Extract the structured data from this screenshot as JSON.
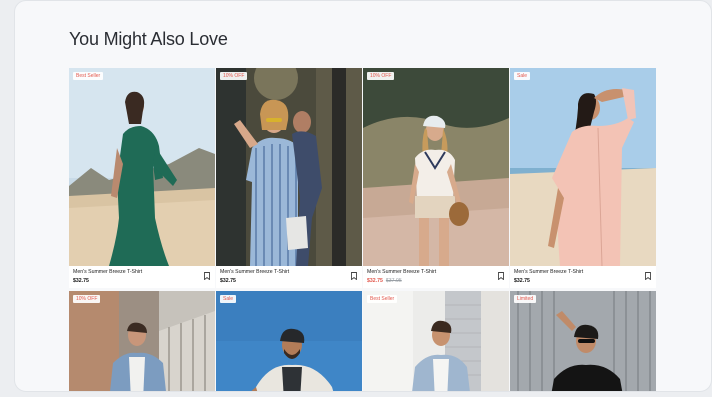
{
  "section": {
    "title": "You Might Also Love"
  },
  "products": [
    {
      "badge": "Best Seller",
      "name": "Men's Summer Breeze T-Shirt",
      "price": "$32.75",
      "old_price": "",
      "on_sale": false,
      "bookmark_icon": "bookmark-icon"
    },
    {
      "badge": "10% OFF",
      "name": "Men's Summer Breeze T-Shirt",
      "price": "$32.75",
      "old_price": "",
      "on_sale": false,
      "bookmark_icon": "bookmark-icon"
    },
    {
      "badge": "10% OFF",
      "name": "Men's Summer Breeze T-Shirt",
      "price": "$32.75",
      "old_price": "$37.95",
      "on_sale": true,
      "bookmark_icon": "bookmark-icon"
    },
    {
      "badge": "Sale",
      "name": "Men's Summer Breeze T-Shirt",
      "price": "$32.75",
      "old_price": "",
      "on_sale": false,
      "bookmark_icon": "bookmark-icon"
    },
    {
      "badge": "10% OFF",
      "name": "",
      "price": "",
      "old_price": "",
      "on_sale": false
    },
    {
      "badge": "Sale",
      "name": "",
      "price": "",
      "old_price": "",
      "on_sale": false
    },
    {
      "badge": "Best Seller",
      "name": "",
      "price": "",
      "old_price": "",
      "on_sale": false
    },
    {
      "badge": "Limited",
      "name": "",
      "price": "",
      "old_price": "",
      "on_sale": false
    }
  ],
  "colors": {
    "badge_text": "#e2574c",
    "sale_price": "#e2574c",
    "title": "#2a2d33"
  }
}
